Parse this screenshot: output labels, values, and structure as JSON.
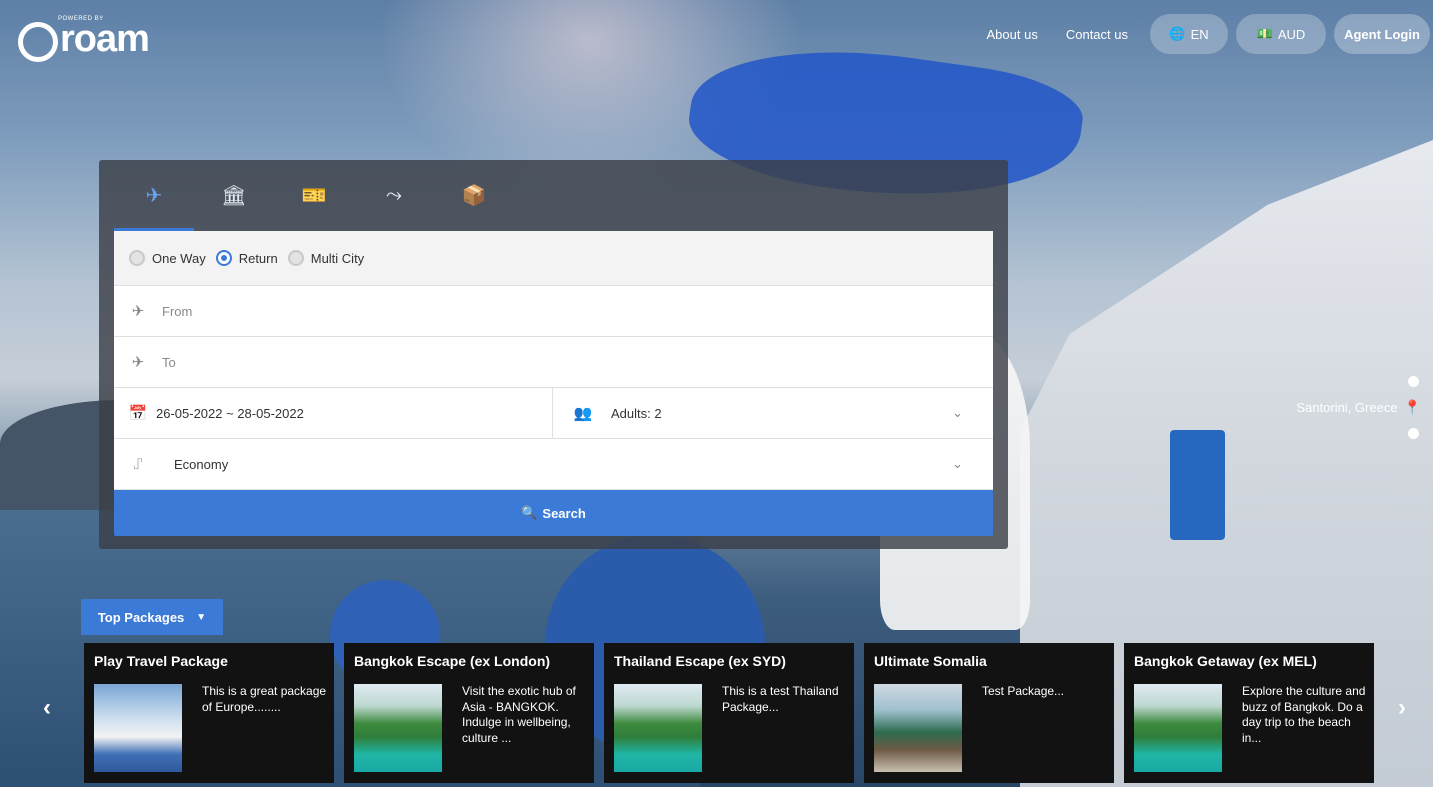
{
  "brand": {
    "powered_by": "POWERED BY",
    "name": "roam"
  },
  "nav": {
    "about": "About us",
    "contact": "Contact us",
    "language": "EN",
    "currency": "AUD",
    "agent_login": "Agent Login"
  },
  "search": {
    "tabs": [
      {
        "icon": "plane-icon",
        "glyph": "✈"
      },
      {
        "icon": "hotel-icon",
        "glyph": "🏛"
      },
      {
        "icon": "ticket-icon",
        "glyph": "🎫"
      },
      {
        "icon": "route-icon",
        "glyph": "⤳"
      },
      {
        "icon": "package-icon",
        "glyph": "📦"
      }
    ],
    "trip_types": [
      "One Way",
      "Return",
      "Multi City"
    ],
    "selected_trip": "Return",
    "from_placeholder": "From",
    "to_placeholder": "To",
    "dates": "26-05-2022 ~ 28-05-2022",
    "travellers": "Adults: 2",
    "cabin": "Economy",
    "search_label": "Search"
  },
  "slider": {
    "location": "Santorini, Greece"
  },
  "packages": {
    "button": "Top Packages",
    "items": [
      {
        "title": "Play Travel Package",
        "desc": "This is a great package of Europe........"
      },
      {
        "title": "Bangkok Escape (ex London)",
        "desc": "Visit the exotic hub of Asia - BANGKOK. Indulge in wellbeing, culture ..."
      },
      {
        "title": "Thailand Escape (ex SYD)",
        "desc": "This is a test Thailand Package..."
      },
      {
        "title": "Ultimate Somalia",
        "desc": "Test Package..."
      },
      {
        "title": "Bangkok Getaway (ex MEL)",
        "desc": "Explore the culture and buzz of Bangkok. Do a day trip to the beach in..."
      }
    ]
  }
}
